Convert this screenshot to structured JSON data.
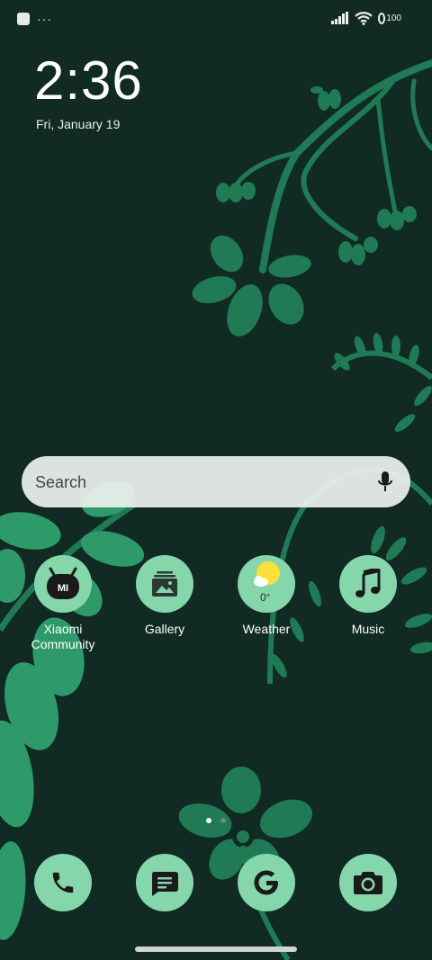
{
  "status_bar": {
    "battery_level": "100",
    "left_dots": "···"
  },
  "clock": {
    "time": "2:36",
    "date": "Fri, January 19"
  },
  "search": {
    "placeholder": "Search"
  },
  "apps": [
    {
      "label": "Xiaomi Community",
      "icon": "xiaomi-community-icon"
    },
    {
      "label": "Gallery",
      "icon": "gallery-icon"
    },
    {
      "label": "Weather",
      "icon": "weather-icon",
      "temp": "0°"
    },
    {
      "label": "Music",
      "icon": "music-icon"
    }
  ],
  "dock": [
    {
      "icon": "phone-icon"
    },
    {
      "icon": "messages-icon"
    },
    {
      "icon": "google-icon"
    },
    {
      "icon": "camera-icon"
    }
  ],
  "page_indicator": {
    "pages": 2,
    "current": 1
  },
  "colors": {
    "background": "#112a24",
    "icon_bg": "#86d6ab",
    "leaf": "#1f7a55",
    "leaf_light": "#2e9a6a"
  }
}
